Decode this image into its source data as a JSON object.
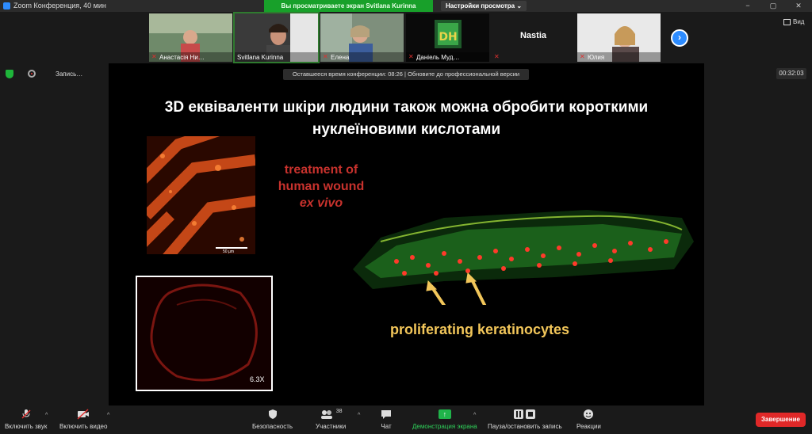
{
  "window": {
    "title": "Zoom Конференция, 40 мин",
    "share_banner": "Вы просматриваете экран Svitlana Kurinna",
    "view_options": "Настройки просмотра ⌄"
  },
  "window_controls": {
    "minimize": "−",
    "maximize": "▢",
    "close": "✕"
  },
  "participants": [
    {
      "name": "Анастасія Ни…",
      "muted": true
    },
    {
      "name": "Svitlana Kurinna",
      "muted": false,
      "active": true
    },
    {
      "name": "Елена",
      "muted": true
    },
    {
      "name": "Даніель Муд…",
      "muted": true
    },
    {
      "name": "",
      "display_name": "Nastia",
      "muted": true
    },
    {
      "name": "Юлия",
      "muted": true
    }
  ],
  "view_button": "Вид",
  "strip_next_icon": "›",
  "recording": {
    "label": "Запись…",
    "pause": "❚❚",
    "timer": "00:32:03"
  },
  "conference_banner": "Оставшееся время конференции: 08:26 | Обновите до профессиональной версии",
  "slide": {
    "title_line1": "3D еквіваленти шкіри людини також можна обробити короткими",
    "title_line2": "нуклеїновими кислотами",
    "treatment_line1": "treatment of",
    "treatment_line2": "human wound",
    "treatment_line3": "ex vivo",
    "scale_label": "50 µm",
    "magnification": "6.3X",
    "caption": "proliferating keratinocytes"
  },
  "toolbar": {
    "unmute": "Включить звук",
    "start_video": "Включить видео",
    "security": "Безопасность",
    "participants": "Участники",
    "participants_count": "38",
    "chat": "Чат",
    "share_screen": "Демонстрация экрана",
    "pause_recording": "Пауза/остановить запись",
    "reactions": "Реакции",
    "end": "Завершение"
  },
  "colors": {
    "share_green": "#18a02a",
    "end_red": "#e02828",
    "accent_blue": "#2d8cff",
    "caption_yellow": "#f2c65a",
    "treatment_red": "#c8322d"
  }
}
